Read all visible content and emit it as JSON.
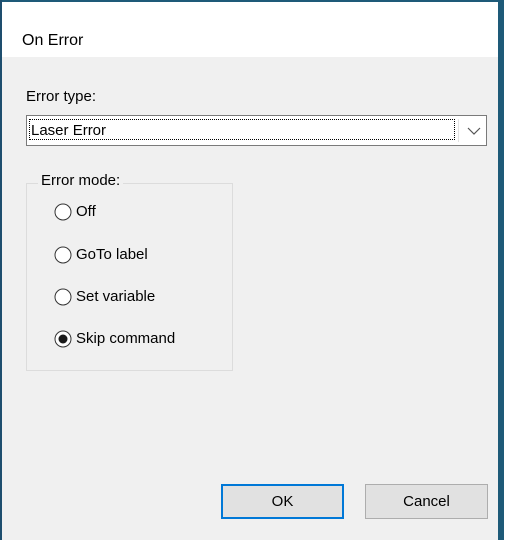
{
  "window": {
    "title": "On Error"
  },
  "error_type": {
    "label": "Error type:",
    "selected": "Laser Error"
  },
  "error_mode": {
    "legend": "Error mode:",
    "options": [
      {
        "label": "Off",
        "checked": false
      },
      {
        "label": "GoTo label",
        "checked": false
      },
      {
        "label": "Set variable",
        "checked": false
      },
      {
        "label": "Skip command",
        "checked": true
      }
    ]
  },
  "buttons": {
    "ok_label": "OK",
    "cancel_label": "Cancel"
  },
  "colors": {
    "accent": "#0078d7",
    "frame": "#1e5a78",
    "dialog_bg": "#f0f0f0"
  }
}
